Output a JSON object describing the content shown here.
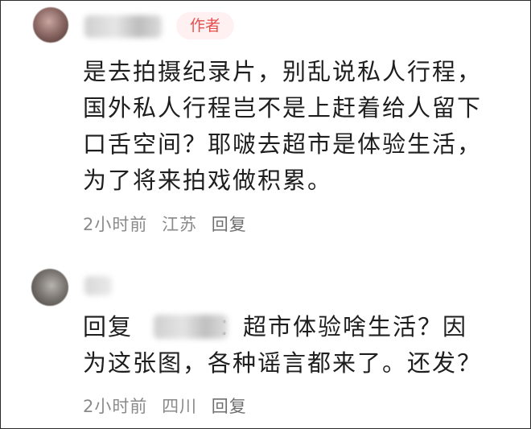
{
  "comments": [
    {
      "author_badge": "作者",
      "lines": [
        "是去拍摄纪录片，别乱说私人行程，",
        "国外私人行程岂不是上赶着给人留下",
        "口舌空间？耶啵去超市是体验生活，",
        "为了将来拍戏做积累。"
      ],
      "time": "2小时前",
      "location": "江苏",
      "reply_label": "回复"
    },
    {
      "reply_prefix": "回复",
      "reply_rest_line1": "：超市体验啥生活？因",
      "line2": "为这张图，各种谣言都来了。还发？",
      "time": "2小时前",
      "location": "四川",
      "reply_label": "回复"
    }
  ]
}
